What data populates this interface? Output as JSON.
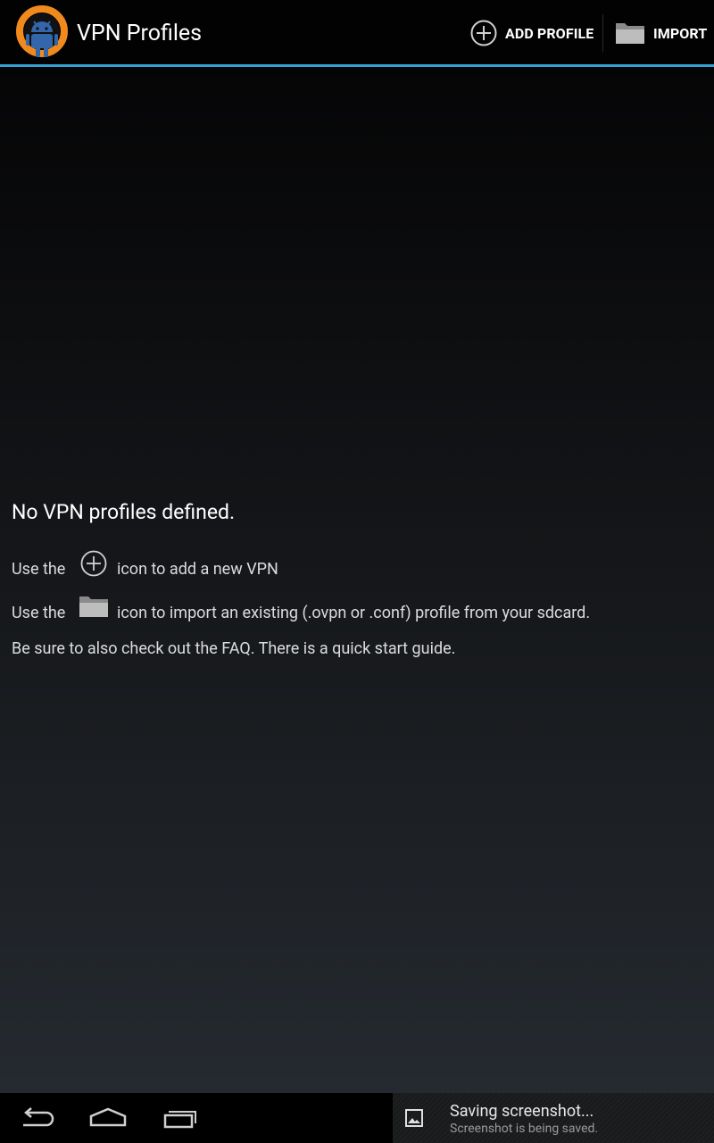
{
  "action_bar": {
    "title": "VPN Profiles",
    "app_icon": "openvpn-android-icon",
    "accent_color": "#33a3d6",
    "actions": [
      {
        "label": "ADD PROFILE",
        "icon": "add-circle-icon"
      },
      {
        "label": "IMPORT",
        "icon": "folder-icon"
      }
    ]
  },
  "empty_state": {
    "title": "No VPN profiles defined.",
    "line1_prefix": "Use the",
    "line1_suffix": "icon to add a new VPN",
    "line2_prefix": "Use the",
    "line2_suffix": "icon to import an existing (.ovpn or .conf) profile from your sdcard.",
    "line3": "Be sure to also check out the FAQ. There is a quick start guide."
  },
  "nav_bar": {
    "buttons": [
      "back-icon",
      "home-icon",
      "recents-icon"
    ]
  },
  "notification": {
    "icon": "image-icon",
    "title": "Saving screenshot...",
    "text": "Screenshot is being saved."
  }
}
